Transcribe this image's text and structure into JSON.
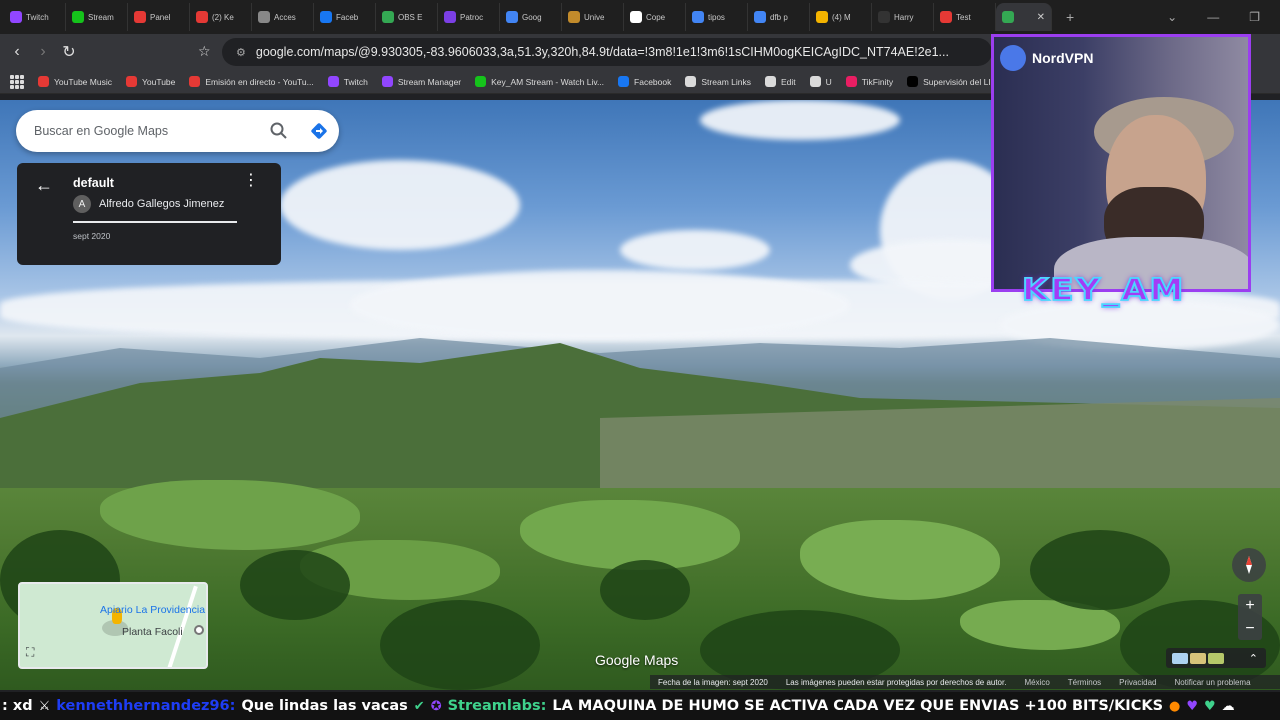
{
  "tabs": [
    {
      "label": "Twitch",
      "color": "#9146ff"
    },
    {
      "label": "Stream",
      "color": "#15c31b"
    },
    {
      "label": "Panel",
      "color": "#e53935"
    },
    {
      "label": "(2) Ke",
      "color": "#e53935"
    },
    {
      "label": "Acces",
      "color": "#888888"
    },
    {
      "label": "Faceb",
      "color": "#1877f2"
    },
    {
      "label": "OBS E",
      "color": "#34a853"
    },
    {
      "label": "Patroc",
      "color": "#7b3fe4"
    },
    {
      "label": "Goog",
      "color": "#4285f4"
    },
    {
      "label": "Unive",
      "color": "#c28b2b"
    },
    {
      "label": "Cope",
      "color": "#ffffff"
    },
    {
      "label": "tipos",
      "color": "#4285f4"
    },
    {
      "label": "dfb p",
      "color": "#4285f4"
    },
    {
      "label": "(4) M",
      "color": "#f4b400"
    },
    {
      "label": "Harry",
      "color": "#333333"
    },
    {
      "label": "Test",
      "color": "#e53935"
    }
  ],
  "active_tab": {
    "close": "✕"
  },
  "new_tab": "+",
  "omnibox": {
    "url": "google.com/maps/@9.930305,-83.9606033,3a,51.3y,320h,84.9t/data=!3m8!1e1!3m6!1sCIHM0ogKEICAgIDC_NT74AE!2e1..."
  },
  "bookmarks": [
    {
      "label": "YouTube Music",
      "color": "#e53935"
    },
    {
      "label": "YouTube",
      "color": "#e53935"
    },
    {
      "label": "Emisión en directo - YouTu...",
      "color": "#e53935"
    },
    {
      "label": "Twitch",
      "color": "#9146ff"
    },
    {
      "label": "Stream Manager",
      "color": "#9146ff"
    },
    {
      "label": "Key_AM Stream - Watch Liv...",
      "color": "#15c31b"
    },
    {
      "label": "Facebook",
      "color": "#1877f2"
    },
    {
      "label": "Stream Links",
      "color": "#dadada"
    },
    {
      "label": "Edit",
      "color": "#dadada"
    },
    {
      "label": "U",
      "color": "#dadada"
    },
    {
      "label": "TikFinity",
      "color": "#e91e63"
    },
    {
      "label": "Supervisión del LI",
      "color": "#000000"
    }
  ],
  "search": {
    "placeholder": "Buscar en Google Maps"
  },
  "info_card": {
    "title": "default",
    "author_initial": "A",
    "author": "Alfredo Gallegos Jimenez",
    "date": "sept 2020"
  },
  "overlay": {
    "sponsor": "NordVPN",
    "streamer": "KEY_AM"
  },
  "minimap": {
    "place_1": "Apiario La Providencia",
    "place_2": "Planta Facoli"
  },
  "logo": "Google Maps",
  "footer": {
    "image_date": "Fecha de la imagen: sept 2020",
    "copyright": "Las imágenes pueden estar protegidas por derechos de autor.",
    "country": "México",
    "terms": "Términos",
    "privacy": "Privacidad",
    "report": "Notificar un problema"
  },
  "ticker": {
    "prefix": ": xd",
    "user": "kennethhernandez96:",
    "message": "Que lindas las vacas",
    "bot": "Streamlabs:",
    "bot_message": "LA MAQUINA DE HUMO SE ACTIVA CADA VEZ QUE ENVIAS +100 BITS/KICKS"
  },
  "controls": {
    "zoom_in": "+",
    "zoom_out": "−"
  }
}
